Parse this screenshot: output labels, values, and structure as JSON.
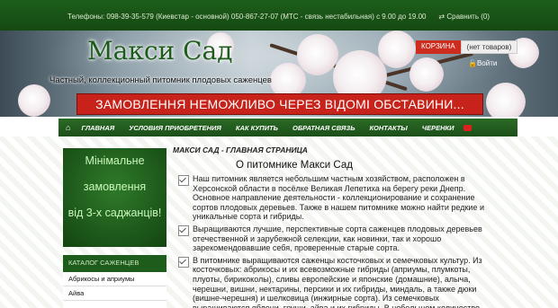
{
  "topbar": {
    "phones": "Телефоны: 098-39-35-579 (Киевстар - основной)          050-867-27-07 (МТС - связь нестабильная) с 9.00 до 19.00",
    "compare": "Сравнить (0)"
  },
  "header": {
    "logo": "Макси Сад",
    "tagline": "Частный, коллекционный питомник плодовых саженцев",
    "cart_label": "КОРЗИНА",
    "cart_status": "(нет товаров)",
    "login": "Войти",
    "notice": "ЗАМОВЛЕННЯ НЕМОЖЛИВО ЧЕРЕЗ ВІДОМІ ОБСТАВИНИ..."
  },
  "nav": {
    "items": [
      "ГЛАВНАЯ",
      "УСЛОВИЯ ПРИОБРЕТЕНИЯ",
      "КАК КУПИТЬ",
      "ОБРАТНАЯ СВЯЗЬ",
      "КОНТАКТЫ",
      "ЧЕРЕНКИ"
    ]
  },
  "promo": {
    "lines": [
      "Мінімальне",
      "замовлення",
      "від 3-х саджанців!"
    ]
  },
  "catalog": {
    "title": "КАТАЛОГ САЖЕНЦЕВ",
    "items": [
      "Абрикосы и априумы",
      "Айва"
    ]
  },
  "content": {
    "breadcrumb": "МАКСИ САД - ГЛАВНАЯ СТРАНИЦА",
    "title": "О питомнике Макси Сад",
    "paragraphs": [
      "Наш питомник является небольшим частным хозяйством, расположен в Херсонской области в посёлке Великая Лепетиха на берегу реки Днепр. Основное направление деятельности - коллекционирование и сохранение сортов плодовых деревьев. Также в нашем питомнике можно найти редкие и уникальные сорта и гибриды.",
      "Выращиваются лучшие, перспективные сорта саженцев плодовых деревьев отечественной и зарубежной селекции, как новинки, так и хорошо зарекомендовавшие себя, проверенные старые сорта.",
      "В питомнике выращиваются саженцы косточковых и семечковых культур. Из косточковых: абрикосы и их всевозможные гибриды (априумы, плумкоты, плуоты, бирикоколы), сливы европейские и японские (домашние), алыча, черешни, вишни, нектарины, персики и их гибриды, миндаль, а также дюки (вишне-черешня) и шелковица (инжирные сорта). Из семечковых выращиваются яблони, груши, айва и их гибриды. В небольшом количестве выращивается хурма, шелковица и сладкий"
    ]
  }
}
